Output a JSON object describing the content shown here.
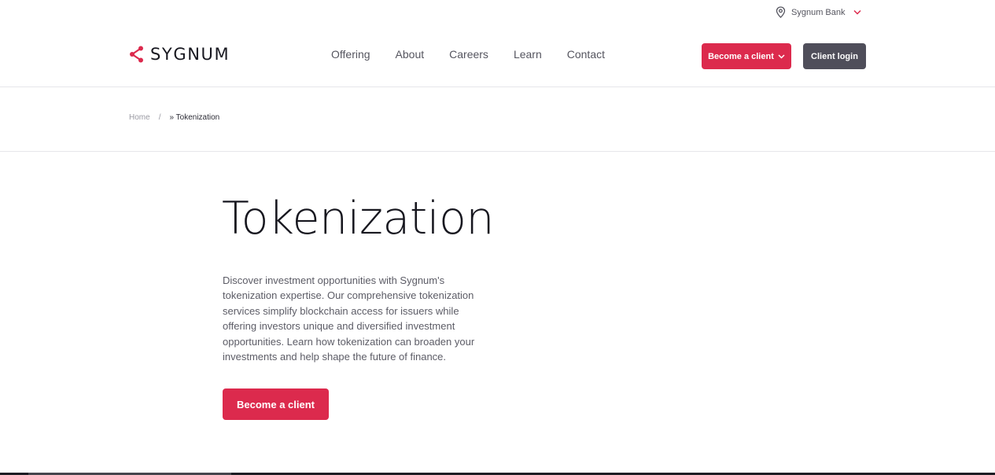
{
  "utility": {
    "region_label": "Sygnum Bank",
    "icon_pin": "location-pin-icon",
    "icon_chevron": "chevron-down-icon"
  },
  "nav": {
    "logo_text": "SYGNUM",
    "logo_icon": "share-nodes-icon",
    "menu": [
      {
        "label": "Offering"
      },
      {
        "label": "About"
      },
      {
        "label": "Careers"
      },
      {
        "label": "Learn"
      },
      {
        "label": "Contact"
      }
    ],
    "become_client_label": "Become a client",
    "client_login_label": "Client login"
  },
  "breadcrumb": {
    "home": "Home",
    "separator": "/",
    "current": "» Tokenization"
  },
  "hero": {
    "title": "Tokenization",
    "description": "Discover investment opportunities with Sygnum's tokenization expertise. Our comprehensive tokenization services simplify blockchain access for issuers while offering investors unique and diversified investment opportunities. Learn how tokenization can broaden your investments and help shape the future of finance.",
    "cta_label": "Become a client"
  },
  "colors": {
    "brand_red": "#dc2a4d",
    "dark_button": "#4f4e5a",
    "text_dark": "#17171f",
    "text_muted": "#5c5c66"
  }
}
